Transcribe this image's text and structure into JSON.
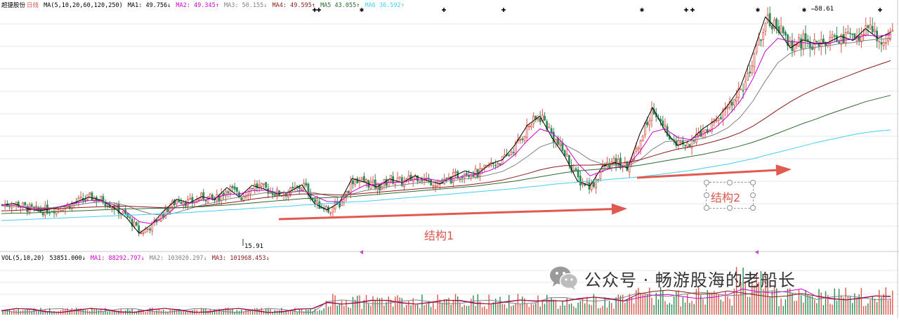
{
  "header": {
    "stock_name": "超捷股份",
    "period": "日线",
    "ma_params": "MA(5,10,20,60,120,250)",
    "ma1": "MA1: 49.756↓",
    "ma2": "MA2: 49.345↑",
    "ma3": "MA3: 50.155↓",
    "ma4": "MA4: 49.595↑",
    "ma5": "MA5  43.055↑",
    "ma6": "MA6  36.592↑"
  },
  "volume_header": {
    "params": "VOL(5,10,20)",
    "vol": "53851.000↓",
    "ma1": "MA1: 88292.797↓",
    "ma2": "MA2: 103020.297↓",
    "ma3": "MA3: 101968.453↓"
  },
  "annotations": {
    "structure1": "结构1",
    "structure2": "结构2",
    "high_label": "58.61",
    "low_label": "15.91"
  },
  "watermark": {
    "text": "公众号 · 畅游股海的老船长",
    "icon": "wechat-icon"
  },
  "colors": {
    "up": "#d9574b",
    "down": "#2e8b57",
    "ma_black": "#000000",
    "ma_magenta": "#cc00cc",
    "ma_gray": "#808080",
    "ma_darkred": "#8b1a1a",
    "ma_green": "#2f6b2f",
    "ma_cyan": "#40d0f0",
    "arrow": "#e05a50",
    "grid": "#e8e8e8"
  },
  "chart_data": {
    "type": "line",
    "title": "超捷股份 日线",
    "price_range": [
      15.91,
      58.61
    ],
    "series": [
      {
        "name": "MA1",
        "color": "#000000",
        "values": [
          22.5,
          22.8,
          21.9,
          21.4,
          21.8,
          22.3,
          23.1,
          24.0,
          23.4,
          22.0,
          20.1,
          17.2,
          18.9,
          21.5,
          23.6,
          22.9,
          24.1,
          23.5,
          25.8,
          24.0,
          26.2,
          25.5,
          24.6,
          25.0,
          26.3,
          22.8,
          21.6,
          23.0,
          27.5,
          26.8,
          25.9,
          27.4,
          26.7,
          28.0,
          27.1,
          26.5,
          27.8,
          28.9,
          28.3,
          30.2,
          31.0,
          33.8,
          37.5,
          39.2,
          35.0,
          31.6,
          27.0,
          26.1,
          29.8,
          30.5,
          29.4,
          36.0,
          40.8,
          36.4,
          33.7,
          34.6,
          36.8,
          38.4,
          41.2,
          44.6,
          51.0,
          57.8,
          55.3,
          52.0,
          53.5,
          52.8,
          53.0,
          54.2,
          53.4,
          55.6,
          53.8,
          54.9
        ]
      },
      {
        "name": "MA2",
        "color": "#cc00cc",
        "values": [
          22.6,
          22.4,
          22.0,
          21.8,
          21.9,
          22.4,
          22.9,
          23.4,
          23.3,
          22.5,
          21.2,
          19.4,
          19.0,
          20.3,
          22.3,
          22.8,
          23.4,
          23.8,
          24.5,
          24.6,
          25.2,
          25.3,
          24.9,
          24.8,
          25.3,
          24.2,
          23.2,
          23.1,
          25.0,
          26.2,
          26.4,
          26.8,
          26.8,
          27.3,
          27.4,
          27.1,
          27.4,
          28.0,
          28.3,
          29.0,
          30.1,
          32.0,
          34.6,
          36.8,
          36.0,
          33.8,
          30.4,
          28.0,
          28.9,
          29.6,
          29.8,
          32.6,
          36.2,
          36.8,
          35.2,
          34.8,
          35.8,
          37.0,
          39.2,
          42.0,
          46.2,
          51.4,
          53.8,
          53.2,
          53.0,
          52.7,
          52.8,
          53.4,
          53.6,
          54.4,
          54.2,
          54.5
        ]
      },
      {
        "name": "MA3",
        "color": "#808080",
        "values": [
          22.4,
          22.4,
          22.2,
          22.0,
          22.0,
          22.2,
          22.5,
          22.9,
          23.1,
          22.9,
          22.4,
          21.5,
          20.8,
          20.6,
          21.1,
          21.8,
          22.5,
          23.0,
          23.6,
          24.0,
          24.4,
          24.8,
          24.9,
          24.9,
          25.1,
          24.8,
          24.3,
          24.0,
          24.6,
          25.2,
          25.6,
          26.0,
          26.3,
          26.6,
          26.8,
          26.9,
          27.1,
          27.4,
          27.7,
          28.2,
          28.8,
          30.0,
          31.6,
          33.4,
          34.2,
          33.8,
          32.6,
          31.0,
          30.2,
          30.0,
          29.8,
          31.0,
          33.0,
          34.4,
          34.6,
          34.6,
          35.0,
          35.8,
          37.0,
          39.0,
          42.0,
          45.8,
          49.2,
          51.0,
          51.8,
          52.1,
          52.4,
          52.8,
          53.0,
          53.4,
          53.6,
          53.8
        ]
      },
      {
        "name": "MA4",
        "color": "#8b1a1a",
        "values": [
          21.4,
          21.5,
          21.6,
          21.7,
          21.8,
          21.9,
          22.0,
          22.1,
          22.2,
          22.3,
          22.3,
          22.2,
          22.1,
          22.0,
          22.0,
          22.1,
          22.3,
          22.6,
          22.9,
          23.2,
          23.6,
          23.9,
          24.2,
          24.4,
          24.6,
          24.6,
          24.5,
          24.4,
          24.5,
          24.7,
          24.9,
          25.1,
          25.3,
          25.5,
          25.7,
          25.8,
          26.0,
          26.2,
          26.5,
          26.8,
          27.2,
          27.8,
          28.4,
          29.1,
          29.6,
          29.9,
          30.0,
          30.0,
          30.1,
          30.3,
          30.5,
          31.0,
          31.7,
          32.4,
          33.0,
          33.4,
          33.9,
          34.5,
          35.2,
          36.1,
          37.3,
          38.8,
          40.4,
          41.9,
          43.2,
          44.3,
          45.3,
          46.2,
          47.1,
          48.0,
          48.8,
          49.6
        ]
      },
      {
        "name": "MA5",
        "color": "#2f6b2f",
        "values": [
          20.9,
          21.0,
          21.0,
          21.1,
          21.2,
          21.3,
          21.4,
          21.5,
          21.6,
          21.7,
          21.8,
          21.8,
          21.9,
          21.9,
          22.0,
          22.1,
          22.2,
          22.4,
          22.5,
          22.7,
          22.9,
          23.1,
          23.3,
          23.5,
          23.7,
          23.8,
          23.9,
          24.0,
          24.1,
          24.3,
          24.5,
          24.7,
          24.9,
          25.1,
          25.3,
          25.5,
          25.7,
          25.9,
          26.1,
          26.4,
          26.7,
          27.0,
          27.4,
          27.8,
          28.2,
          28.6,
          28.9,
          29.1,
          29.3,
          29.5,
          29.7,
          30.0,
          30.4,
          30.8,
          31.2,
          31.6,
          32.0,
          32.5,
          33.0,
          33.6,
          34.3,
          35.1,
          36.0,
          36.9,
          37.8,
          38.6,
          39.5,
          40.3,
          41.1,
          41.9,
          42.5,
          43.1
        ]
      },
      {
        "name": "MA6",
        "color": "#40d0f0",
        "values": [
          19.6,
          19.7,
          19.8,
          19.9,
          20.0,
          20.1,
          20.2,
          20.3,
          20.4,
          20.5,
          20.6,
          20.7,
          20.8,
          20.9,
          21.0,
          21.1,
          21.3,
          21.4,
          21.6,
          21.7,
          21.9,
          22.0,
          22.2,
          22.3,
          22.5,
          22.6,
          22.8,
          22.9,
          23.1,
          23.2,
          23.4,
          23.6,
          23.8,
          24.0,
          24.2,
          24.4,
          24.6,
          24.8,
          25.0,
          25.2,
          25.4,
          25.6,
          25.9,
          26.1,
          26.4,
          26.6,
          26.8,
          27.0,
          27.2,
          27.4,
          27.6,
          27.8,
          28.1,
          28.4,
          28.7,
          29.0,
          29.4,
          29.8,
          30.2,
          30.7,
          31.2,
          31.8,
          32.4,
          33.0,
          33.6,
          34.2,
          34.7,
          35.2,
          35.7,
          36.1,
          36.4,
          36.6
        ]
      }
    ]
  }
}
